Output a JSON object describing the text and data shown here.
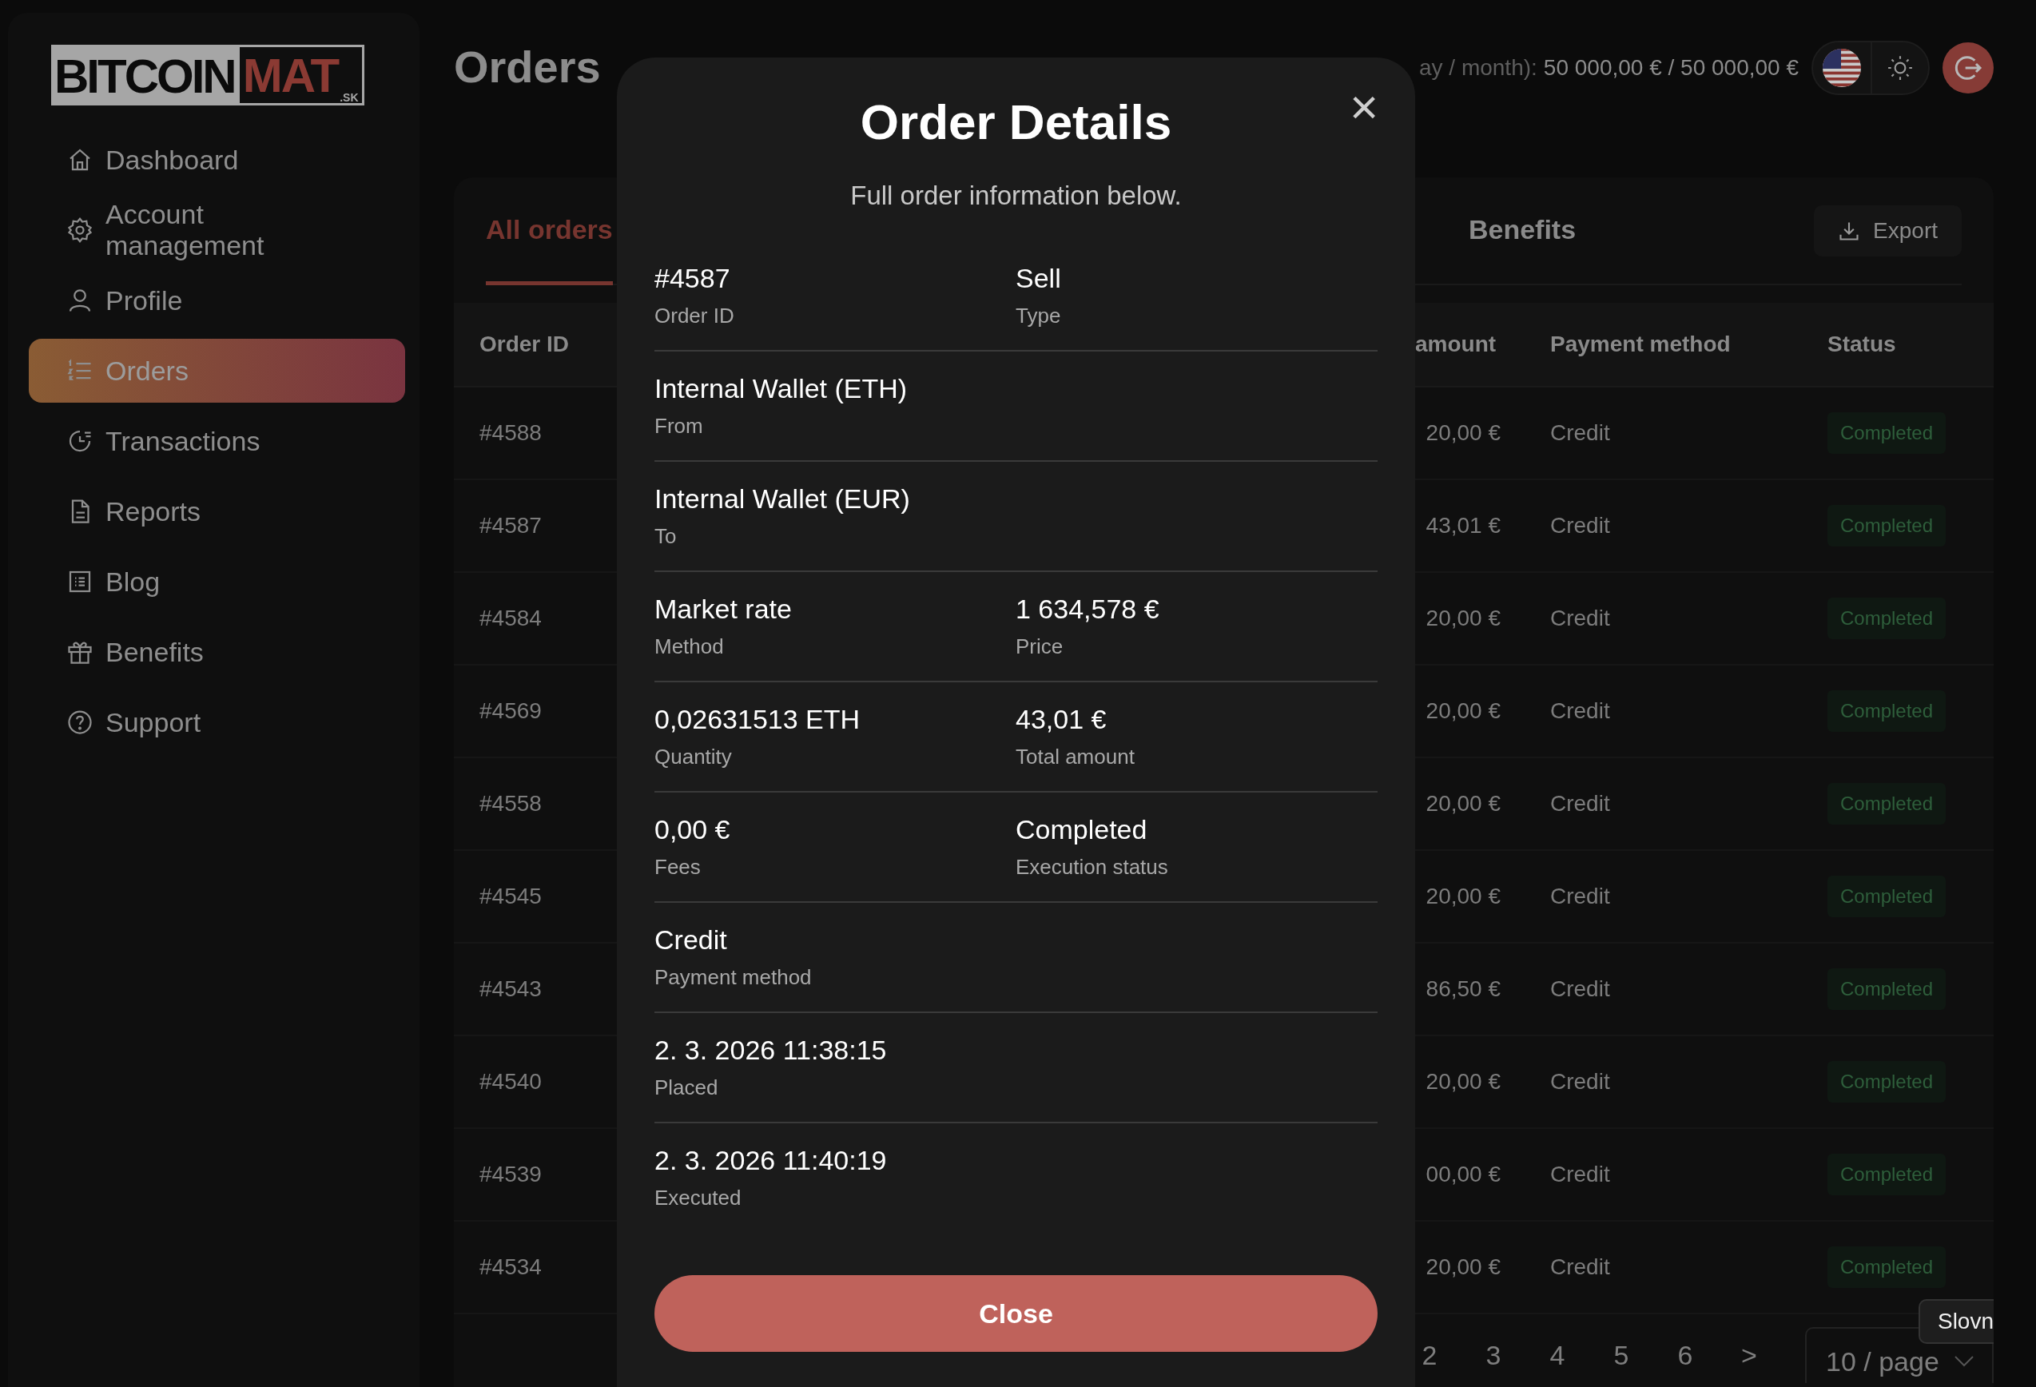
{
  "logo": {
    "main": "BITCOIN",
    "accent": "MAT",
    "suffix": ".SK"
  },
  "sidebar": {
    "items": [
      {
        "label": "Dashboard",
        "selected": false
      },
      {
        "label": "Account management",
        "selected": false
      },
      {
        "label": "Profile",
        "selected": false
      },
      {
        "label": "Orders",
        "selected": true
      },
      {
        "label": "Transactions",
        "selected": false
      },
      {
        "label": "Reports",
        "selected": false
      },
      {
        "label": "Blog",
        "selected": false
      },
      {
        "label": "Benefits",
        "selected": false
      },
      {
        "label": "Support",
        "selected": false
      }
    ]
  },
  "header": {
    "title": "Orders",
    "limit_label": "ay / month):",
    "limit_value": "50 000,00 € / 50 000,00 €"
  },
  "tabs": [
    {
      "label": "All orders",
      "selected": true
    },
    {
      "label": "Benefits",
      "selected": false
    }
  ],
  "export_button": "Export",
  "table": {
    "columns": [
      "Order ID",
      "amount",
      "Payment method",
      "Status"
    ],
    "rows": [
      {
        "id": "#4588",
        "amount": "20,00 €",
        "payment": "Credit",
        "status": "Completed"
      },
      {
        "id": "#4587",
        "amount": "43,01 €",
        "payment": "Credit",
        "status": "Completed"
      },
      {
        "id": "#4584",
        "amount": "20,00 €",
        "payment": "Credit",
        "status": "Completed"
      },
      {
        "id": "#4569",
        "amount": "20,00 €",
        "payment": "Credit",
        "status": "Completed"
      },
      {
        "id": "#4558",
        "amount": "20,00 €",
        "payment": "Credit",
        "status": "Completed"
      },
      {
        "id": "#4545",
        "amount": "20,00 €",
        "payment": "Credit",
        "status": "Completed"
      },
      {
        "id": "#4543",
        "amount": "86,50 €",
        "payment": "Credit",
        "status": "Completed"
      },
      {
        "id": "#4540",
        "amount": "20,00 €",
        "payment": "Credit",
        "status": "Completed"
      },
      {
        "id": "#4539",
        "amount": "00,00 €",
        "payment": "Credit",
        "status": "Completed"
      },
      {
        "id": "#4534",
        "amount": "20,00 €",
        "payment": "Credit",
        "status": "Completed"
      }
    ]
  },
  "pagination": {
    "pages": [
      "2",
      "3",
      "4",
      "5",
      "6"
    ],
    "next": ">",
    "page_size": "10 / page"
  },
  "tooltip": "Slovn",
  "modal": {
    "title": "Order Details",
    "subtitle": "Full order information below.",
    "close_icon": "×",
    "rows": [
      [
        {
          "value": "#4587",
          "label": "Order ID"
        },
        {
          "value": "Sell",
          "label": "Type"
        }
      ],
      [
        {
          "value": "Internal Wallet (ETH)",
          "label": "From"
        }
      ],
      [
        {
          "value": "Internal Wallet (EUR)",
          "label": "To"
        }
      ],
      [
        {
          "value": "Market rate",
          "label": "Method"
        },
        {
          "value": "1 634,578 €",
          "label": "Price"
        }
      ],
      [
        {
          "value": "0,02631513 ETH",
          "label": "Quantity"
        },
        {
          "value": "43,01 €",
          "label": "Total amount"
        }
      ],
      [
        {
          "value": "0,00 €",
          "label": "Fees"
        },
        {
          "value": "Completed",
          "label": "Execution status"
        }
      ],
      [
        {
          "value": "Credit",
          "label": "Payment method"
        }
      ],
      [
        {
          "value": "2. 3. 2026 11:38:15",
          "label": "Placed"
        }
      ],
      [
        {
          "value": "2. 3. 2026 11:40:19",
          "label": "Executed"
        }
      ]
    ],
    "close_button": "Close"
  }
}
